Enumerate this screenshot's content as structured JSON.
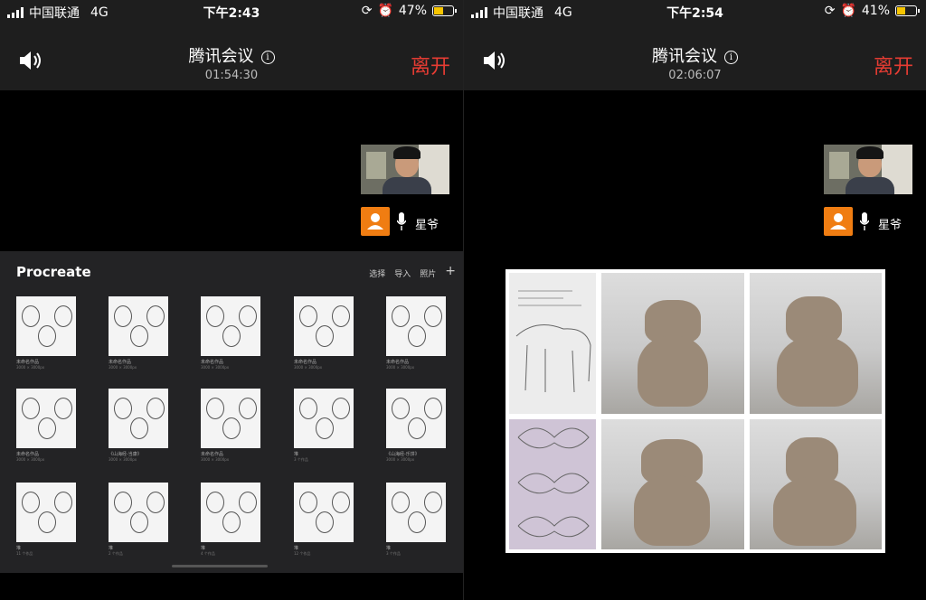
{
  "screens": [
    {
      "status": {
        "carrier": "中国联通",
        "network": "4G",
        "time": "下午2:43",
        "battery": "47%",
        "battery_level": 0.47
      },
      "meeting": {
        "title": "腾讯会议",
        "timer": "01:54:30",
        "leave_label": "离开"
      },
      "participant": {
        "name": "星爷"
      },
      "procreate": {
        "title": "Procreate",
        "actions": [
          "选择",
          "导入",
          "照片",
          "+"
        ],
        "items": [
          {
            "caption": "未命名作品",
            "sub": "3000 × 3000px"
          },
          {
            "caption": "未命名作品",
            "sub": "3000 × 3000px"
          },
          {
            "caption": "未命名作品",
            "sub": "3000 × 3000px"
          },
          {
            "caption": "未命名作品",
            "sub": "3000 × 3000px"
          },
          {
            "caption": "未命名作品",
            "sub": "3000 × 3000px"
          },
          {
            "caption": "未命名作品",
            "sub": "3000 × 3000px"
          },
          {
            "caption": "《山海经-当康》",
            "sub": "3000 × 3000px"
          },
          {
            "caption": "未命名作品",
            "sub": "3000 × 3000px"
          },
          {
            "caption": "堆",
            "sub": "3 个作品"
          },
          {
            "caption": "《山海经-乐饼》",
            "sub": "3000 × 3000px"
          },
          {
            "caption": "堆",
            "sub": "11 个作品"
          },
          {
            "caption": "堆",
            "sub": "2 个作品"
          },
          {
            "caption": "堆",
            "sub": "4 个作品"
          },
          {
            "caption": "堆",
            "sub": "12 个作品"
          },
          {
            "caption": "堆",
            "sub": "3 个作品"
          }
        ]
      }
    },
    {
      "status": {
        "carrier": "中国联通",
        "network": "4G",
        "time": "下午2:54",
        "battery": "41%",
        "battery_level": 0.41
      },
      "meeting": {
        "title": "腾讯会议",
        "timer": "02:06:07",
        "leave_label": "离开"
      },
      "participant": {
        "name": "星爷"
      }
    }
  ],
  "colors": {
    "leave": "#e63c33",
    "avatar": "#f07d12",
    "bar": "#1e1e1e",
    "battery": "#f7c500"
  }
}
